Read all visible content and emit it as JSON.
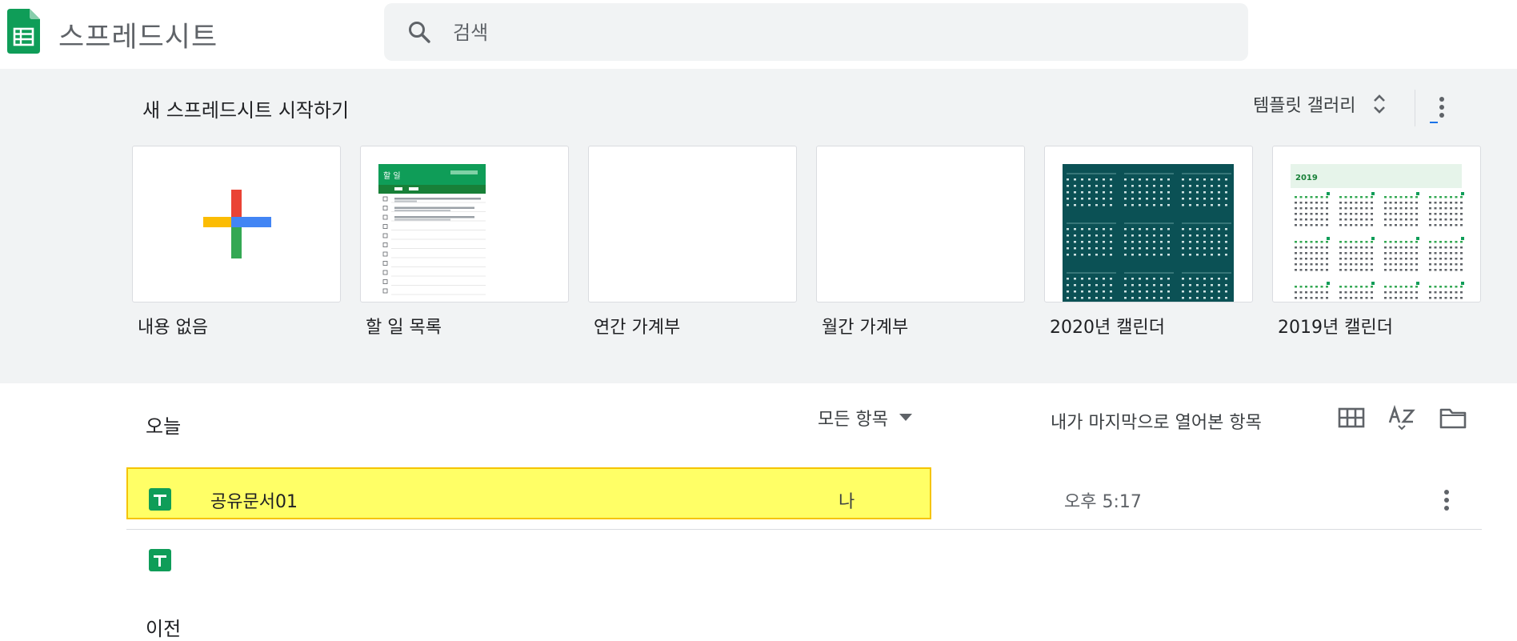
{
  "header": {
    "app_title": "스프레드시트",
    "search_placeholder": "검색",
    "logo_icon": "google-sheets-logo",
    "search_icon": "search-icon"
  },
  "templates": {
    "title": "새 스프레드시트 시작하기",
    "gallery_label": "템플릿 갤러리",
    "cards": [
      {
        "label": "내용 없음",
        "thumb": "blank-plus"
      },
      {
        "label": "할 일 목록",
        "thumb": "todo-list",
        "thumb_title": "할 일"
      },
      {
        "label": "연간 가계부",
        "thumb": "blank"
      },
      {
        "label": "월간 가계부",
        "thumb": "blank"
      },
      {
        "label": "2020년 캘린더",
        "thumb": "calendar-teal"
      },
      {
        "label": "2019년 캘린더",
        "thumb": "calendar-light",
        "thumb_year": "2019"
      }
    ]
  },
  "list": {
    "section_today": "오늘",
    "filter_label": "모든 항목",
    "sort_label": "내가 마지막으로 열어본 항목",
    "section_previous": "이전",
    "files": [
      {
        "name": "공유문서01",
        "owner": "나",
        "time": "오후 5:17",
        "highlighted": true
      },
      {
        "name": "",
        "owner": "",
        "time": ""
      }
    ]
  },
  "colors": {
    "sheets_green": "#0f9d58",
    "highlight": "#ffff66",
    "highlight_border": "#f5c400",
    "teal_calendar": "#0b5155"
  }
}
